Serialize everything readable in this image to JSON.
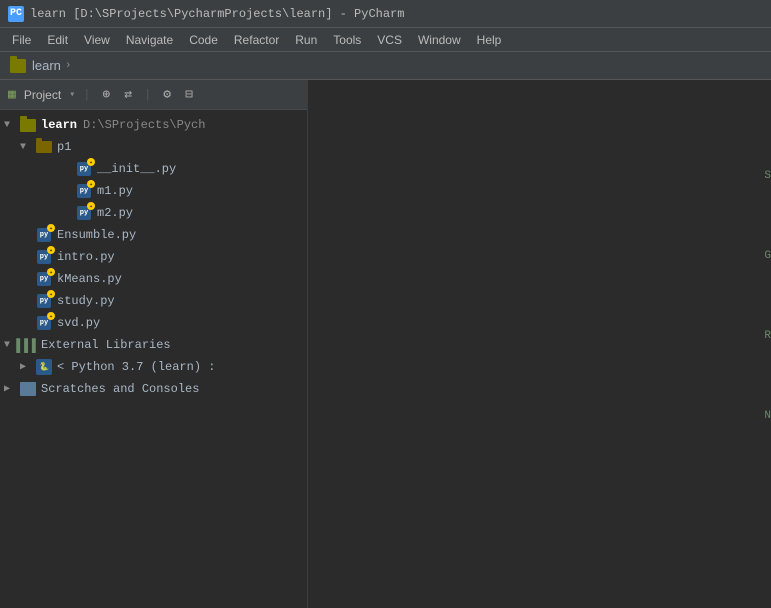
{
  "titlebar": {
    "icon": "PC",
    "text": "learn [D:\\SProjects\\PycharmProjects\\learn] - PyCharm"
  },
  "menubar": {
    "items": [
      "File",
      "Edit",
      "View",
      "Navigate",
      "Code",
      "Refactor",
      "Run",
      "Tools",
      "VCS",
      "Window",
      "Help"
    ]
  },
  "breadcrumb": {
    "folder_label": "learn",
    "arrow": "›"
  },
  "sidebar": {
    "toolbar": {
      "project_label": "Project",
      "dropdown_arrow": "▾"
    },
    "tree": {
      "root": {
        "label": "learn",
        "path": "D:\\SProjects\\Pych"
      },
      "p1_folder": "p1",
      "files_in_p1": [
        "__init__.py",
        "m1.py",
        "m2.py"
      ],
      "root_files": [
        "Ensumble.py",
        "intro.py",
        "kMeans.py",
        "study.py",
        "svd.py"
      ],
      "external_libraries": "External Libraries",
      "python_env": "< Python 3.7 (learn) :",
      "scratches": "Scratches and Consoles"
    }
  },
  "editor": {
    "right_labels": [
      "S",
      "G",
      "R",
      "N"
    ]
  }
}
